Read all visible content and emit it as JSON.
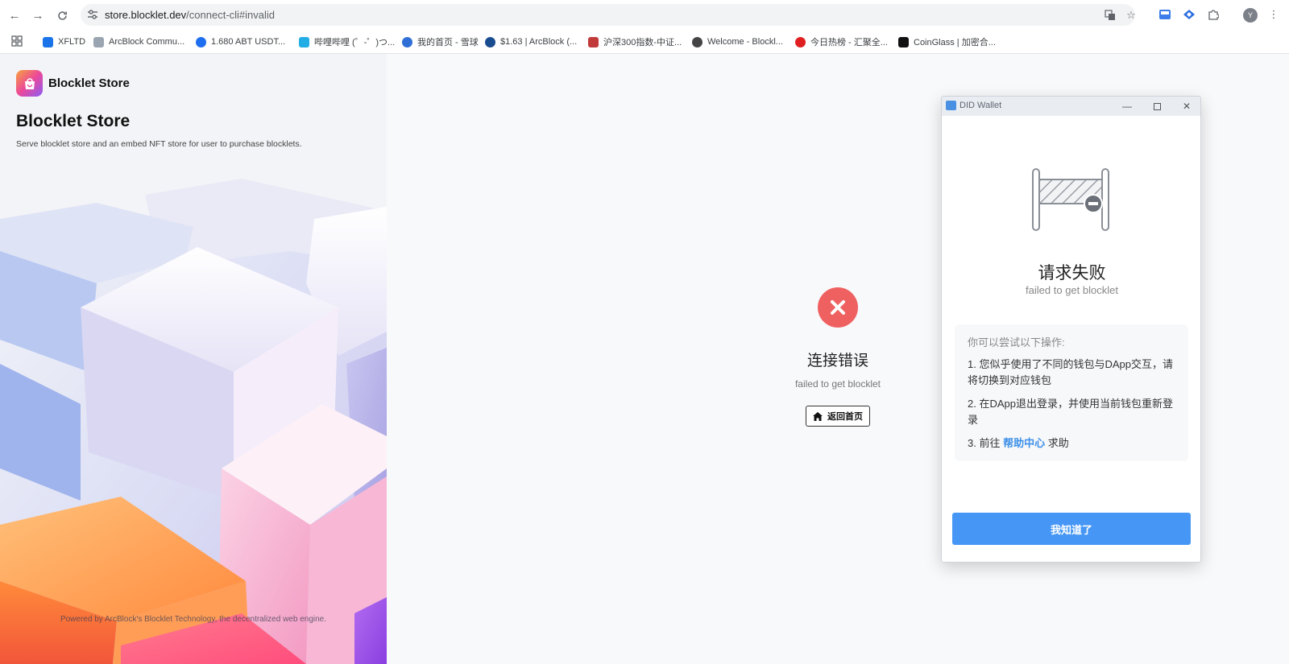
{
  "browser": {
    "url_host": "store.blocklet.dev",
    "url_path": "/connect-cli#invalid",
    "avatar_initial": "Y"
  },
  "bookmarks": [
    {
      "label": "XFLTD",
      "color": "#1a73e8"
    },
    {
      "label": "ArcBlock Commu...",
      "color": "#9aa5b1"
    },
    {
      "label": "1.680 ABT USDT...",
      "color": "#1e6ff0"
    },
    {
      "label": "哔哩哔哩 (゜-゜)つ...",
      "color": "#23ade5"
    },
    {
      "label": "我的首页 - 雪球",
      "color": "#2f6fd6"
    },
    {
      "label": "$1.63 | ArcBlock (...",
      "color": "#1a4d8f"
    },
    {
      "label": "沪深300指数-中证...",
      "color": "#c23b3b"
    },
    {
      "label": "Welcome - Blockl...",
      "color": "#444444"
    },
    {
      "label": "今日热榜 - 汇聚全...",
      "color": "#e02020"
    },
    {
      "label": "CoinGlass | 加密合...",
      "color": "#111111"
    }
  ],
  "left_panel": {
    "brand_name": "Blocklet Store",
    "title": "Blocklet Store",
    "description": "Serve blocklet store and an embed NFT store for user to purchase blocklets.",
    "powered_by": "Powered by ArcBlock's Blocklet Technology, the decentralized web engine."
  },
  "error": {
    "title": "连接错误",
    "subtitle": "failed to get blocklet",
    "home_button": "返回首页",
    "icon_color": "#ef6161"
  },
  "wallet": {
    "window_title": "DID Wallet",
    "heading": "请求失败",
    "subheading": "failed to get blocklet",
    "tips_heading": "你可以尝试以下操作:",
    "tip1": "1. 您似乎使用了不同的钱包与DApp交互，请将切换到对应钱包",
    "tip2": "2. 在DApp退出登录，并使用当前钱包重新登录",
    "tip3_prefix": "3. 前往 ",
    "tip3_link": "帮助中心",
    "tip3_suffix": " 求助",
    "ok_button": "我知道了",
    "accent_color": "#4596f5"
  }
}
